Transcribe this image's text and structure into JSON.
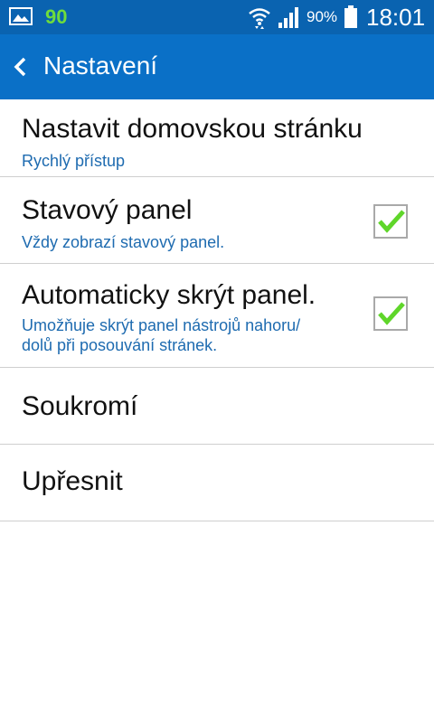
{
  "status_bar": {
    "notification_count": "90",
    "battery_percent": "90%",
    "time": "18:01",
    "icons": [
      "gallery-icon",
      "wifi-icon",
      "signal-icon",
      "battery-icon"
    ]
  },
  "action_bar": {
    "title": "Nastavení",
    "back_icon": "chevron-left-icon",
    "color": "#0a70c7"
  },
  "items": [
    {
      "title": "Nastavit domovskou stránku",
      "subtitle": "Rychlý přístup"
    },
    {
      "title": "Stavový panel",
      "subtitle": "Vždy zobrazí stavový panel.",
      "checked": true
    },
    {
      "title": "Automaticky skrýt panel.",
      "subtitle_line1": "Umožňuje skrýt panel nástrojů nahoru/",
      "subtitle_line2": "dolů při posouvání stránek.",
      "checked": true
    },
    {
      "title": "Soukromí"
    },
    {
      "title": "Upřesnit"
    }
  ],
  "colors": {
    "status_bar": "#0a63b0",
    "subtitle": "#1e6bb0",
    "checkmark": "#5fd62a"
  }
}
